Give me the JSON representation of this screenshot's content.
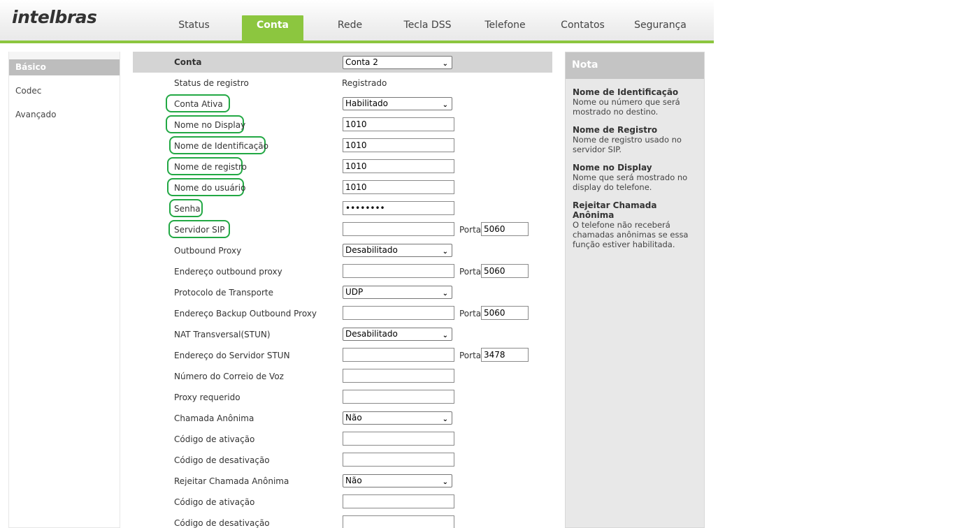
{
  "header": {
    "logo": "intelbras",
    "tabs": [
      "Status",
      "Conta",
      "Rede",
      "Tecla DSS",
      "Telefone",
      "Contatos",
      "Segurança"
    ],
    "active_tab": "Conta"
  },
  "sidebar": {
    "items": [
      "Básico",
      "Codec",
      "Avançado"
    ],
    "active": "Básico"
  },
  "form": {
    "header_label": "Conta",
    "header_select": "Conta 2",
    "porta_label": "Porta",
    "rows": [
      {
        "label": "Status de registro",
        "type": "text",
        "value": "Registrado"
      },
      {
        "label": "Conta Ativa",
        "type": "select",
        "value": "Habilitado",
        "circled": true
      },
      {
        "label": "Nome no Display",
        "type": "input",
        "value": "1010",
        "circled": true
      },
      {
        "label": "Nome de Identificação",
        "type": "input",
        "value": "1010",
        "circled": true
      },
      {
        "label": "Nome de registro",
        "type": "input",
        "value": "1010",
        "circled": true
      },
      {
        "label": "Nome do usuário",
        "type": "input",
        "value": "1010",
        "circled": true
      },
      {
        "label": "Senha",
        "type": "password",
        "value": "••••••••",
        "circled": true
      },
      {
        "label": "Servidor SIP",
        "type": "input",
        "value": "",
        "porta": "5060",
        "circled": true
      },
      {
        "label": "Outbound Proxy",
        "type": "select",
        "value": "Desabilitado"
      },
      {
        "label": "Endereço outbound proxy",
        "type": "input",
        "value": "",
        "porta": "5060"
      },
      {
        "label": "Protocolo de Transporte",
        "type": "select",
        "value": "UDP"
      },
      {
        "label": "Endereço Backup Outbound Proxy",
        "type": "input",
        "value": "",
        "porta": "5060"
      },
      {
        "label": "NAT Transversal(STUN)",
        "type": "select",
        "value": "Desabilitado"
      },
      {
        "label": "Endereço do Servidor STUN",
        "type": "input",
        "value": "",
        "porta": "3478"
      },
      {
        "label": "Número do Correio de Voz",
        "type": "input",
        "value": ""
      },
      {
        "label": "Proxy requerido",
        "type": "input",
        "value": ""
      },
      {
        "label": "Chamada Anônima",
        "type": "select",
        "value": "Não"
      },
      {
        "label": "Código de ativação",
        "type": "input",
        "value": ""
      },
      {
        "label": "Código de desativação",
        "type": "input",
        "value": ""
      },
      {
        "label": "Rejeitar Chamada Anônima",
        "type": "select",
        "value": "Não"
      },
      {
        "label": "Código de ativação",
        "type": "input",
        "value": ""
      },
      {
        "label": "Código de desativação",
        "type": "input",
        "value": ""
      }
    ]
  },
  "note": {
    "title": "Nota",
    "items": [
      {
        "title": "Nome de Identificação",
        "text": "Nome ou número que será mostrado no destino."
      },
      {
        "title": "Nome de Registro",
        "text": "Nome de registro usado no servidor SIP."
      },
      {
        "title": "Nome no Display",
        "text": "Nome que será mostrado no display do telefone."
      },
      {
        "title": "Rejeitar Chamada Anônima",
        "text": "O telefone não receberá chamadas anônimas se essa função estiver habilitada."
      }
    ]
  },
  "colors": {
    "accent": "#8cc63f",
    "circle_annotation": "#22a844"
  }
}
